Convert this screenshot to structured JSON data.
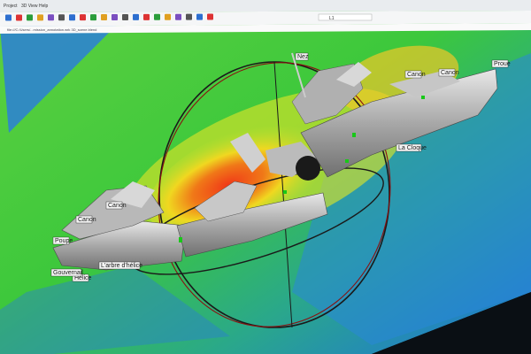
{
  "app": {
    "menu": [
      "Project",
      "3D View",
      "Help"
    ],
    "path_text": "file:///C:/Users/...mission_annotation.wrk 3D_scene.blend",
    "toolbar_icons": [
      "new-icon",
      "open-icon",
      "save-icon",
      "undo-icon",
      "redo-icon",
      "cut-icon",
      "delete-icon",
      "copy-icon",
      "pointer-icon",
      "measure-icon",
      "cube-icon",
      "layer-icon",
      "grid-icon",
      "camera-icon",
      "light-icon",
      "render-icon",
      "settings-icon",
      "help-icon",
      "info-icon",
      "close-icon"
    ],
    "status_field": "L1"
  },
  "scene": {
    "annotations": [
      {
        "key": "nez",
        "text": "Nez"
      },
      {
        "key": "canon_top_right",
        "text": "Canon"
      },
      {
        "key": "canon_right",
        "text": "Canon"
      },
      {
        "key": "proue",
        "text": "Proue"
      },
      {
        "key": "la_cloque",
        "text": "La Cloque"
      },
      {
        "key": "canon_mid",
        "text": "Canon"
      },
      {
        "key": "canon_left",
        "text": "Canon"
      },
      {
        "key": "poupe",
        "text": "Poupe"
      },
      {
        "key": "helice",
        "text": "Hélice"
      },
      {
        "key": "arbre",
        "text": "L'arbre d'hélice"
      },
      {
        "key": "gouvernail",
        "text": "Gouvernail"
      }
    ],
    "colors": {
      "deep": "#1e6fe0",
      "mid": "#3cc83c",
      "shallow": "#f0e020",
      "peak": "#f04020"
    }
  }
}
